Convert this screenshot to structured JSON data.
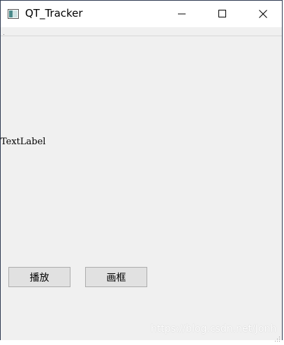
{
  "window": {
    "title": "QT_Tracker",
    "controls": {
      "minimize_icon": "minimize-icon",
      "maximize_icon": "maximize-icon",
      "close_icon": "close-icon"
    }
  },
  "main": {
    "text_label": "TextLabel",
    "buttons": [
      {
        "label": "播放"
      },
      {
        "label": "画框"
      }
    ]
  },
  "watermark": "https://blog.csdn.net/Jonh",
  "colors": {
    "window_bg": "#f0f0f0",
    "titlebar_bg": "#ffffff",
    "button_bg": "#e1e1e1",
    "button_border": "#adadad",
    "window_border": "#2f3b52"
  }
}
